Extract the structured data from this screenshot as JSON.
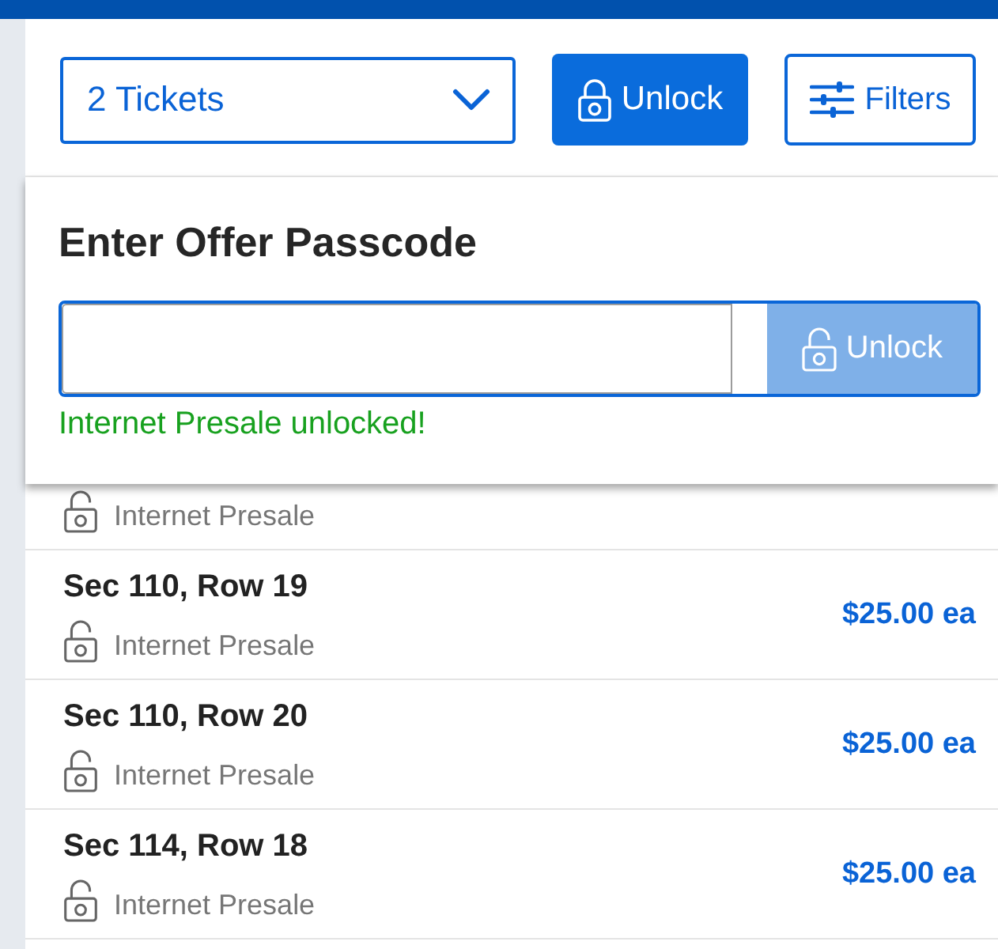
{
  "controls": {
    "quantity_select": {
      "value": "2 Tickets"
    },
    "unlock_button": {
      "label": "Unlock"
    },
    "filters_button": {
      "label": "Filters"
    }
  },
  "passcode_popover": {
    "title": "Enter Offer Passcode",
    "unlock_button": {
      "label": "Unlock",
      "disabled": true
    },
    "message": "Internet Presale unlocked!"
  },
  "listings": [
    {
      "tag": "Internet Presale"
    },
    {
      "seat": "Sec 110, Row 19",
      "tag": "Internet Presale",
      "price": "$25.00 ea"
    },
    {
      "seat": "Sec 110, Row 20",
      "tag": "Internet Presale",
      "price": "$25.00 ea"
    },
    {
      "seat": "Sec 114, Row 18",
      "tag": "Internet Presale",
      "price": "$25.00 ea"
    }
  ]
}
